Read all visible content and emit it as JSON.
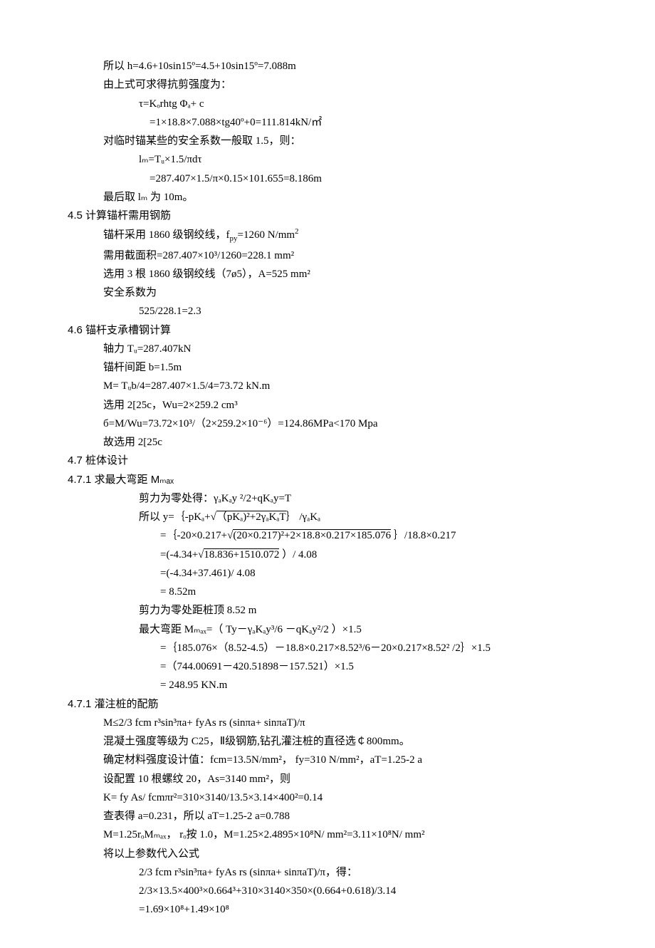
{
  "l1": "所以 h=4.6+10sin15º=4.5+10sin15º=7.088m",
  "l2": "由上式可求得抗剪强度为：",
  "l3": "τ=Kₒrhtg Φₐ+ c",
  "l4": "=1×18.8×7.088×tg40º+0=111.814kN/㎡",
  "l5": "对临时锚某些的安全系数一般取 1.5，则：",
  "l6": "lₘ=Tᵤ×1.5/πdτ",
  "l7": "=287.407×1.5/π×0.15×101.655=8.186m",
  "l8": "最后取 lₘ 为 10m。",
  "s45": "4.5 计算锚杆需用钢筋",
  "l9a": "锚杆采用 1860 级钢绞线，f",
  "l9b": "=1260 N/mm",
  "l10": "需用截面积=287.407×10³/1260=228.1 mm²",
  "l11": "选用 3 根 1860 级钢绞线（7ø5），A=525 mm²",
  "l12": "安全系数为",
  "l13": "525/228.1=2.3",
  "s46": "4.6 锚杆支承槽钢计算",
  "l14": "轴力 Tᵤ=287.407kN",
  "l15": "锚杆间距 b=1.5m",
  "l16": "M= Tᵤb/4=287.407×1.5/4=73.72 kN.m",
  "l17": "选用 2[25c，Wu=2×259.2 cm³",
  "l18": "б=M/Wu=73.72×10³/（2×259.2×10⁻⁶）=124.86MPa<170 Mpa",
  "l19": "故选用 2[25c",
  "s47": "4.7 桩体设计",
  "s471": "4.7.1 求最大弯距 Mₘₐₓ",
  "l20": "剪力为零处得：γₐKₐy ²/2+qKₐy=T",
  "l21a": "所以 y=｛-pKₐ+√",
  "l21b": "（pKₐ)²+2γₐKₐT",
  "l21c": "｝ /γₐKₐ",
  "l22a": "=｛-20×0.217+√",
  "l22b": "(20×0.217)²+2×18.8×0.217×185.076",
  "l22c": " ｝/18.8×0.217",
  "l23a": "=(-4.34+√",
  "l23b": "18.836+1510.072",
  "l23c": " ）/ 4.08",
  "l24": "=(-4.34+37.461)/ 4.08",
  "l25": "= 8.52m",
  "l26": "剪力为零处距桩顶 8.52 m",
  "l27": "最大弯距 Mₘₐₓ=（ Ty－γₐKₐy³/6 －qKₐy²/2 ）×1.5",
  "l28": "=｛185.076×（8.52-4.5）－18.8×0.217×8.52³/6－20×0.217×8.52² /2｝×1.5",
  "l29": "=（744.00691－420.51898－157.521）×1.5",
  "l30": "= 248.95 KN.m",
  "s472": "4.7.1 灌注桩的配筋",
  "l31": "M≤2/3 fcm r³sin³πa+ fyAs rs (sinπa+ sinπaT)/π",
  "l32": "混凝土强度等级为 C25，Ⅱ级钢筋,钻孔灌注桩的直径选￠800mm。",
  "l33": "确定材料强度设计值：fcm=13.5N/mm²，  fy=310 N/mm²，aT=1.25-2 a",
  "l34": "设配置 10 根螺纹 20，As=3140 mm²，则",
  "l35": "K= fy As/ fcmπr²=310×3140/13.5×3.14×400²=0.14",
  "l36": "查表得 a=0.231，所以 aT=1.25-2 a=0.788",
  "l37": "M=1.25rₒMₘₐₓ， rₒ按 1.0，M=1.25×2.4895×10⁸N/ mm²=3.11×10⁸N/ mm²",
  "l38": "将以上参数代入公式",
  "l39": "2/3 fcm r³sin³πa+ fyAs rs (sinπa+ sinπaT)/π，得：",
  "l40": "2/3×13.5×400³×0.664³+310×3140×350×(0.664+0.618)/3.14",
  "l41": "=1.69×10⁸+1.49×10⁸"
}
